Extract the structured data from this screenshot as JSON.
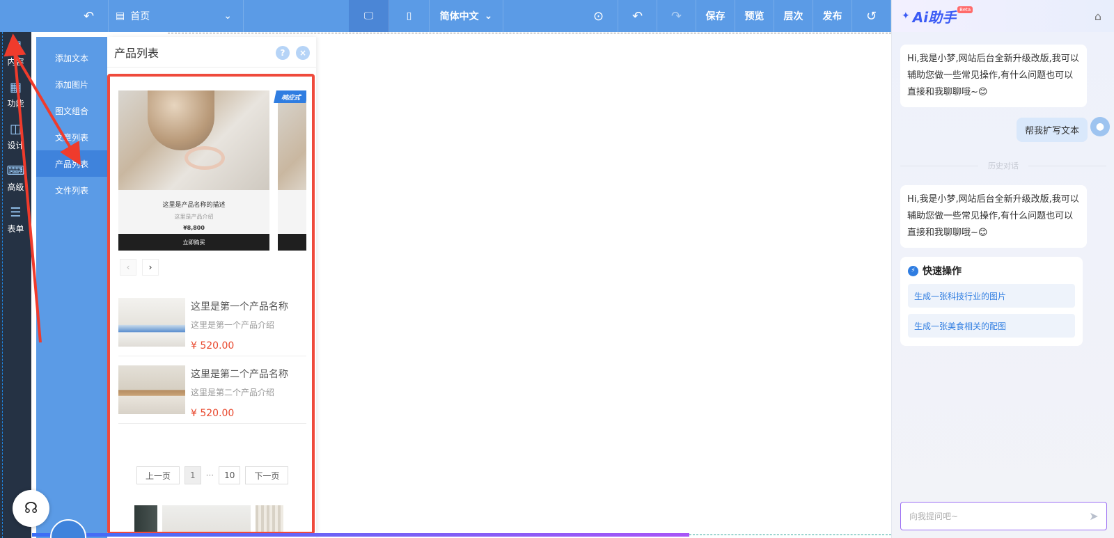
{
  "toolbar": {
    "page_name": "首页",
    "language": "简体中文",
    "save": "保存",
    "preview": "预览",
    "layers": "层次",
    "publish": "发布"
  },
  "rail": {
    "items": [
      {
        "label": "内容"
      },
      {
        "label": "功能"
      },
      {
        "label": "设计"
      },
      {
        "label": "高级"
      },
      {
        "label": "表单"
      }
    ]
  },
  "submenu": {
    "items": [
      {
        "label": "添加文本"
      },
      {
        "label": "添加图片"
      },
      {
        "label": "图文组合"
      },
      {
        "label": "文章列表"
      },
      {
        "label": "产品列表"
      },
      {
        "label": "文件列表"
      }
    ],
    "active": "产品列表"
  },
  "panel": {
    "title": "产品列表",
    "help": "?",
    "close": "×",
    "carousel": {
      "tag": "响应式",
      "name": "这里是产品名称的描述",
      "desc": "这里是产品介绍",
      "price": "¥8,800",
      "button": "立即购买"
    },
    "products": [
      {
        "name": "这里是第一个产品名称",
        "desc": "这里是第一个产品介绍",
        "price": "¥ 520.00"
      },
      {
        "name": "这里是第二个产品名称",
        "desc": "这里是第二个产品介绍",
        "price": "¥ 520.00"
      }
    ],
    "pager": {
      "prev": "上一页",
      "current": "1",
      "dots": "···",
      "last": "10",
      "next": "下一页"
    }
  },
  "ai": {
    "logo": "Ai助手",
    "beta": "Beta",
    "greeting": "Hi,我是小梦,网站后台全新升级改版,我可以辅助您做一些常见操作,有什么问题也可以直接和我聊聊哦~😊",
    "user_message": "帮我扩写文本",
    "history_label": "历史对话",
    "quick": {
      "title": "快速操作",
      "items": [
        {
          "label": "生成一张科技行业的图片"
        },
        {
          "label": "生成一张美食相关的配图"
        }
      ]
    },
    "input_placeholder": "向我提问吧~"
  },
  "colors": {
    "toolbar": "#5b9be6",
    "rail": "#253244",
    "highlight_frame": "#ef4a3c",
    "price": "#e8462b",
    "ai_accent": "#2f7de1"
  }
}
